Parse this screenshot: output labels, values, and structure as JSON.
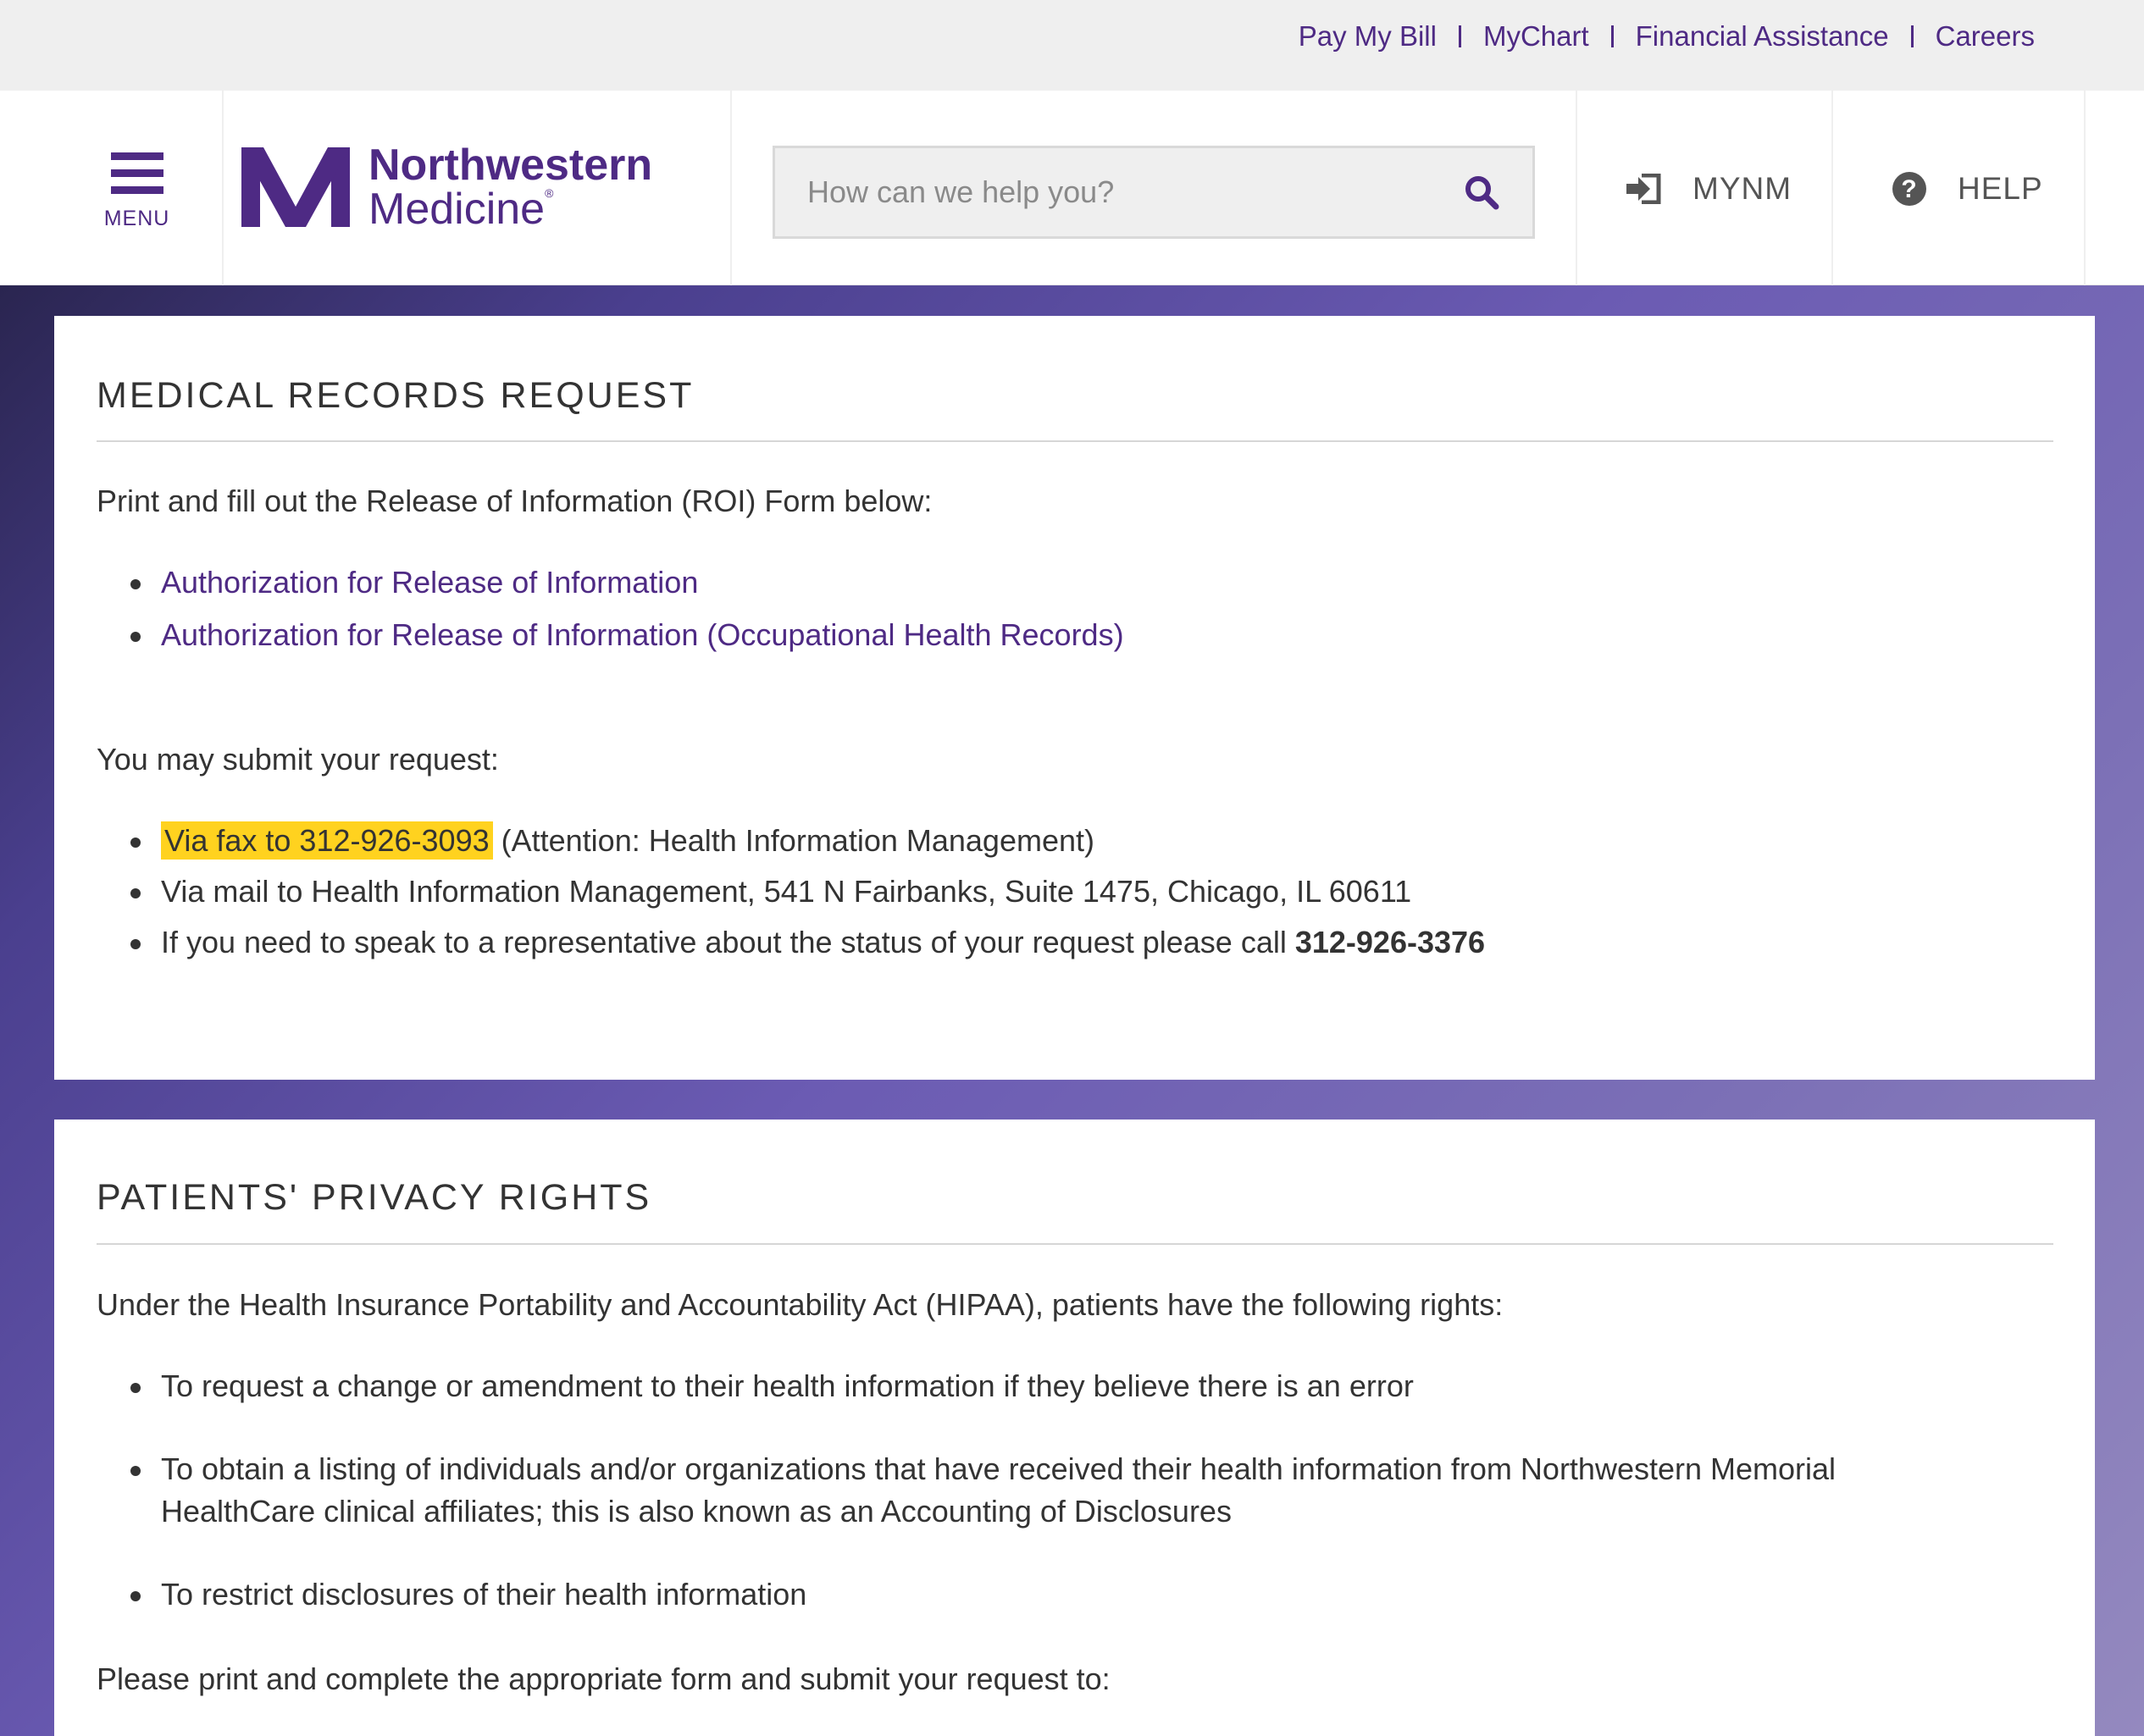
{
  "utility_nav": {
    "links": [
      "Pay My Bill",
      "MyChart",
      "Financial Assistance",
      "Careers"
    ]
  },
  "header": {
    "menu_label": "MENU",
    "logo_line1": "Northwestern",
    "logo_line2": "Medicine",
    "logo_reg": "®",
    "search_placeholder": "How can we help you?",
    "mynm_label": "MYNM",
    "help_label": "HELP"
  },
  "colors": {
    "brand_purple": "#4e2a84",
    "highlight": "#ffd21f"
  },
  "icons": {
    "menu": "hamburger-icon",
    "search": "search-icon",
    "mynm": "login-icon",
    "help": "question-circle-icon"
  },
  "medical_records": {
    "title": "MEDICAL RECORDS REQUEST",
    "intro": "Print and fill out the Release of Information (ROI) Form below:",
    "forms": [
      "Authorization for Release of Information",
      "Authorization for Release of Information (Occupational Health Records)"
    ],
    "submit_intro": "You may submit your request:",
    "fax_highlight": "Via fax to 312-926-3093",
    "fax_rest": " (Attention: Health Information Management)",
    "mail": "Via mail to Health Information Management, 541 N Fairbanks, Suite 1475, Chicago, IL 60611",
    "call_text": "If you need to speak to a representative about the status of your request please call ",
    "call_number": "312-926-3376"
  },
  "privacy_rights": {
    "title": "PATIENTS' PRIVACY RIGHTS",
    "intro": "Under the Health Insurance Portability and Accountability Act (HIPAA), patients have the following rights:",
    "rights": [
      "To request a change or amendment to their health information if they believe there is an error",
      "To obtain a listing of individuals and/or organizations that have received their health information from Northwestern Memorial",
      "HealthCare clinical affiliates; this is also known as an Accounting of Disclosures",
      "To restrict disclosures of their health information"
    ],
    "closing": "Please print and complete the appropriate form and submit your request to:"
  }
}
